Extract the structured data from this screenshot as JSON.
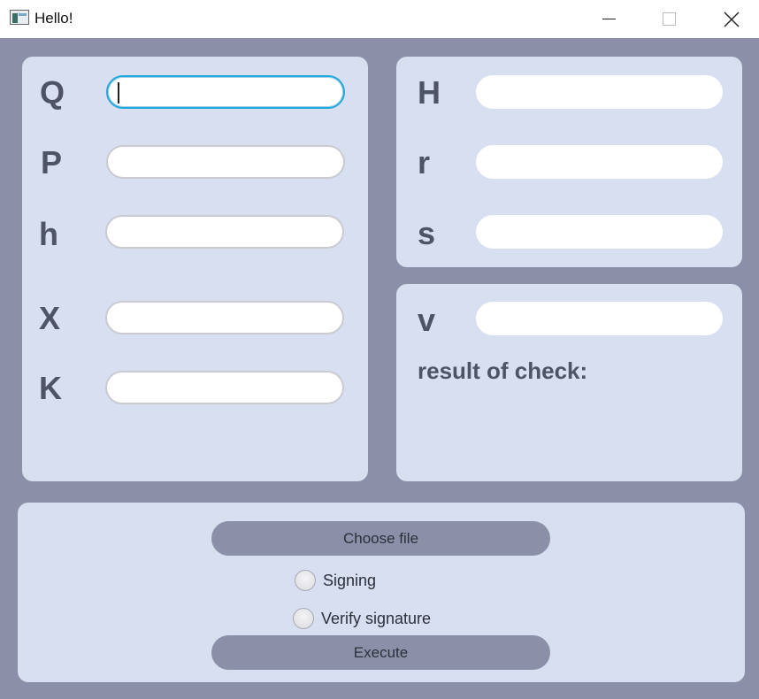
{
  "window": {
    "title": "Hello!",
    "icon": "app-window-icon",
    "controls": [
      "minimize-icon",
      "maximize-icon",
      "close-icon"
    ]
  },
  "left_panel": {
    "fields": [
      {
        "label": "Q",
        "value": ""
      },
      {
        "label": "P",
        "value": ""
      },
      {
        "label": "h",
        "value": ""
      },
      {
        "label": "X",
        "value": ""
      },
      {
        "label": "K",
        "value": ""
      }
    ]
  },
  "right_top_panel": {
    "fields": [
      {
        "label": "H",
        "value": ""
      },
      {
        "label": "r",
        "value": ""
      },
      {
        "label": "s",
        "value": ""
      }
    ]
  },
  "right_bottom_panel": {
    "field": {
      "label": "v",
      "value": ""
    },
    "result_label": "result of check:"
  },
  "bottom_panel": {
    "choose_file_label": "Choose file",
    "mode_options": [
      {
        "label": "Signing",
        "selected": false
      },
      {
        "label": "Verify signature",
        "selected": false
      }
    ],
    "execute_label": "Execute"
  },
  "colors": {
    "background": "#8b90a8",
    "panel": "#d7dff0",
    "label": "#4e5366",
    "focus": "#27a6d8"
  }
}
